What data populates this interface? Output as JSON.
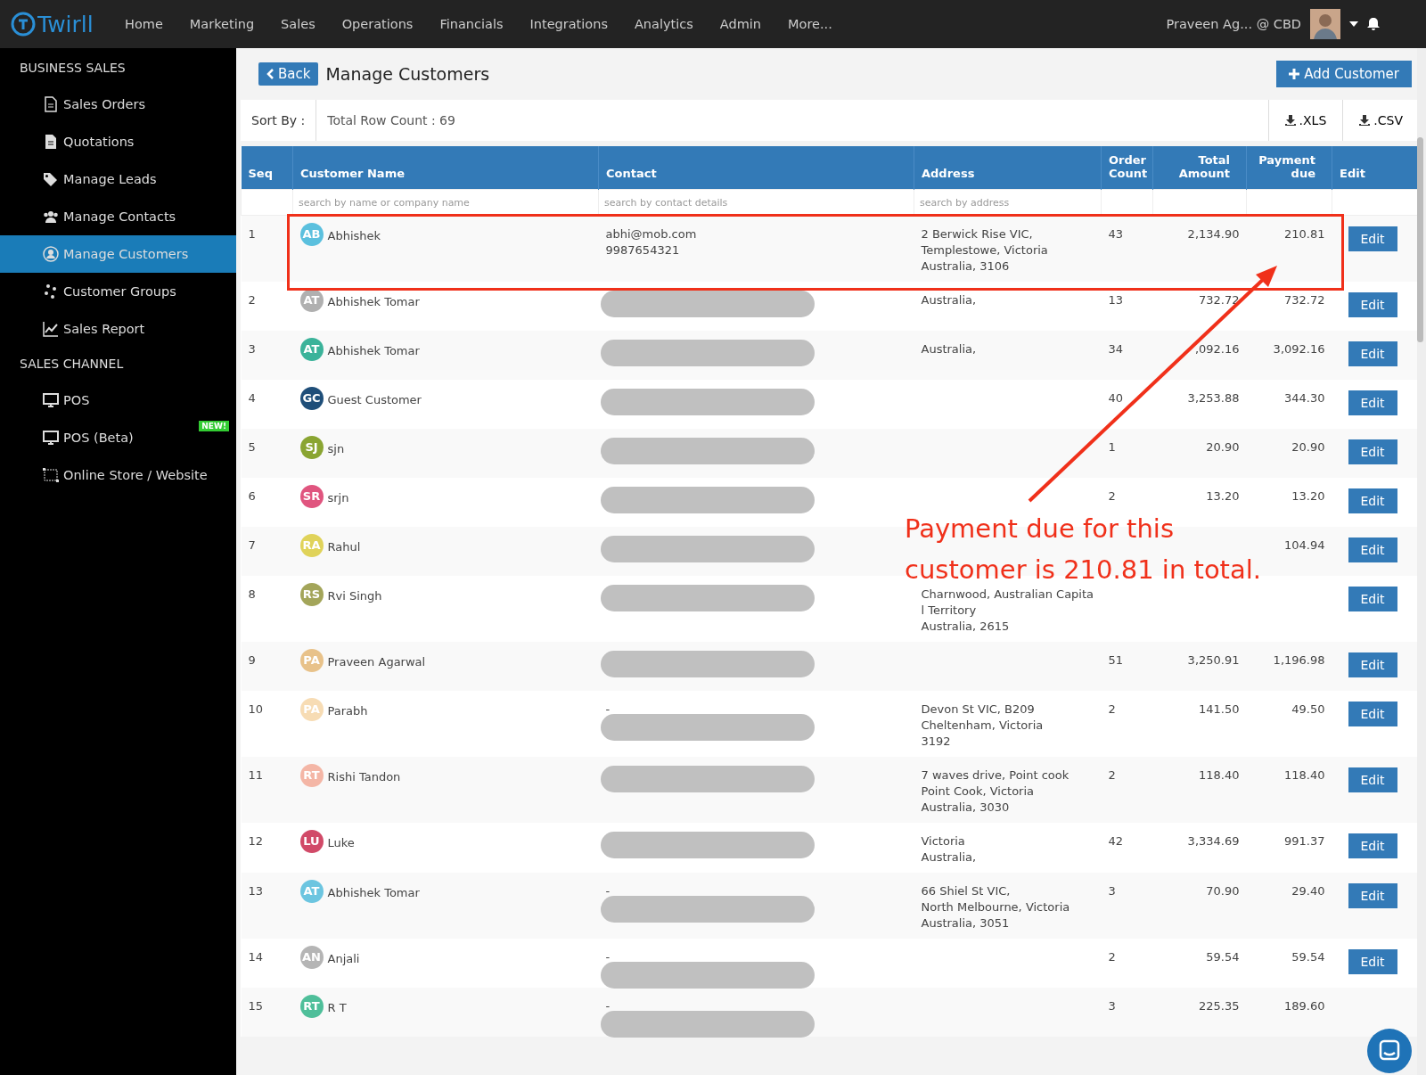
{
  "topbar": {
    "logo": "Twirll",
    "nav": [
      "Home",
      "Marketing",
      "Sales",
      "Operations",
      "Financials",
      "Integrations",
      "Analytics",
      "Admin",
      "More..."
    ],
    "user": "Praveen Ag... @ CBD"
  },
  "sidebar": {
    "sections": [
      {
        "title": "BUSINESS SALES",
        "items": [
          {
            "label": "Sales Orders",
            "selected": false
          },
          {
            "label": "Quotations",
            "selected": false
          },
          {
            "label": "Manage Leads",
            "selected": false
          },
          {
            "label": "Manage Contacts",
            "selected": false
          },
          {
            "label": "Manage Customers",
            "selected": true
          },
          {
            "label": "Customer Groups",
            "selected": false
          },
          {
            "label": "Sales Report",
            "selected": false
          }
        ]
      },
      {
        "title": "SALES CHANNEL",
        "items": [
          {
            "label": "POS",
            "selected": false
          },
          {
            "label": "POS (Beta)",
            "selected": false,
            "badge": "NEW!"
          },
          {
            "label": "Online Store / Website",
            "selected": false
          }
        ]
      }
    ]
  },
  "header": {
    "back": "Back",
    "title": "Manage Customers",
    "add": "Add Customer"
  },
  "toolbar": {
    "sort": "Sort By :",
    "count": "Total Row Count : 69",
    "exports": [
      ".XLS",
      ".CSV"
    ]
  },
  "table": {
    "columns": [
      "Seq",
      "Customer Name",
      "Contact",
      "Address",
      "Order Count",
      "Total Amount",
      "Payment due",
      "Edit"
    ],
    "filters": [
      {
        "placeholder": "search by name or company name"
      },
      {
        "placeholder": "search by contact details"
      },
      {
        "placeholder": "search by address"
      }
    ],
    "rows": [
      {
        "seq": "1",
        "initials": "AB",
        "color": "#5bc0de",
        "name": "Abhishek",
        "contact": [
          "abhi@mob.com",
          "9987654321"
        ],
        "redacted": false,
        "address": [
          "2 Berwick Rise VIC,",
          "Templestowe, Victoria",
          "Australia, 3106"
        ],
        "orders": "43",
        "total": "2,134.90",
        "due": "210.81",
        "edit": "Edit"
      },
      {
        "seq": "2",
        "initials": "AT",
        "color": "#b0b0b0",
        "name": "Abhishek Tomar",
        "contact": [],
        "redacted": true,
        "address": [
          "Australia,"
        ],
        "orders": "13",
        "total": "732.72",
        "due": "732.72",
        "edit": "Edit"
      },
      {
        "seq": "3",
        "initials": "AT",
        "color": "#3bb39a",
        "name": "Abhishek Tomar",
        "contact": [],
        "redacted": true,
        "address": [
          "Australia,"
        ],
        "orders": "34",
        "total": ",092.16",
        "due": "3,092.16",
        "edit": "Edit"
      },
      {
        "seq": "4",
        "initials": "GC",
        "color": "#1f4e79",
        "name": "Guest Customer",
        "contact": [],
        "redacted": true,
        "address": [],
        "orders": "40",
        "total": "3,253.88",
        "due": "344.30",
        "edit": "Edit"
      },
      {
        "seq": "5",
        "initials": "SJ",
        "color": "#8aa532",
        "name": "sjn",
        "contact": [],
        "redacted": true,
        "address": [],
        "orders": "1",
        "total": "20.90",
        "due": "20.90",
        "edit": "Edit"
      },
      {
        "seq": "6",
        "initials": "SR",
        "color": "#e0557f",
        "name": "srjn",
        "contact": [],
        "redacted": true,
        "address": [],
        "orders": "2",
        "total": "13.20",
        "due": "13.20",
        "edit": "Edit"
      },
      {
        "seq": "7",
        "initials": "RA",
        "color": "#e0d35a",
        "name": "Rahul",
        "contact": [],
        "redacted": true,
        "address": [],
        "orders": "",
        "total": "",
        "due": "104.94",
        "edit": "Edit"
      },
      {
        "seq": "8",
        "initials": "RS",
        "color": "#a3a55a",
        "name": "Rvi Singh",
        "contact": [],
        "redacted": true,
        "address": [
          "Charnwood, Australian Capita",
          "l Territory",
          "Australia, 2615"
        ],
        "orders": "",
        "total": "",
        "due": "",
        "edit": "Edit"
      },
      {
        "seq": "9",
        "initials": "PA",
        "color": "#e8c28a",
        "name": "Praveen Agarwal",
        "contact": [],
        "redacted": true,
        "address": [],
        "orders": "51",
        "total": "3,250.91",
        "due": "1,196.98",
        "edit": "Edit"
      },
      {
        "seq": "10",
        "initials": "PA",
        "color": "#f7dcb4",
        "name": "Parabh",
        "contact": [
          "-"
        ],
        "redacted": true,
        "address": [
          "Devon St VIC, B209",
          "Cheltenham, Victoria",
          "3192"
        ],
        "orders": "2",
        "total": "141.50",
        "due": "49.50",
        "edit": "Edit"
      },
      {
        "seq": "11",
        "initials": "RT",
        "color": "#f4b6a6",
        "name": "Rishi Tandon",
        "contact": [],
        "redacted": true,
        "address": [
          "7 waves drive, Point cook",
          "Point Cook, Victoria",
          "Australia, 3030"
        ],
        "orders": "2",
        "total": "118.40",
        "due": "118.40",
        "edit": "Edit"
      },
      {
        "seq": "12",
        "initials": "LU",
        "color": "#d14a68",
        "name": "Luke",
        "contact": [],
        "redacted": true,
        "address": [
          "Victoria",
          "Australia,"
        ],
        "orders": "42",
        "total": "3,334.69",
        "due": "991.37",
        "edit": "Edit"
      },
      {
        "seq": "13",
        "initials": "AT",
        "color": "#6cc5e0",
        "name": "Abhishek Tomar",
        "contact": [
          "-"
        ],
        "redacted": true,
        "address": [
          "66 Shiel St VIC,",
          "North Melbourne, Victoria",
          "Australia, 3051"
        ],
        "orders": "3",
        "total": "70.90",
        "due": "29.40",
        "edit": "Edit"
      },
      {
        "seq": "14",
        "initials": "AN",
        "color": "#b5b5b5",
        "name": "Anjali",
        "contact": [
          "-"
        ],
        "redacted": true,
        "address": [],
        "orders": "2",
        "total": "59.54",
        "due": "59.54",
        "edit": "Edit"
      },
      {
        "seq": "15",
        "initials": "RT",
        "color": "#4fbf9a",
        "name": "R T",
        "contact": [
          "-"
        ],
        "redacted": true,
        "address": [],
        "orders": "3",
        "total": "225.35",
        "due": "189.60"
      }
    ]
  },
  "annotation": {
    "lines": [
      "Payment due for this",
      "customer is 210.81 in total."
    ]
  }
}
